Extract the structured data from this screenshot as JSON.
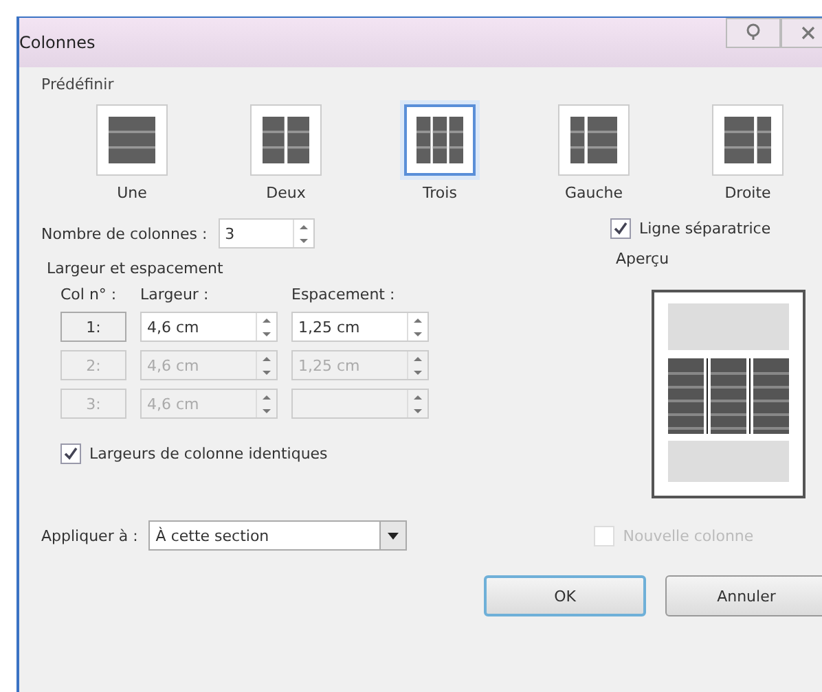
{
  "window": {
    "title": "Colonnes"
  },
  "presets": {
    "label": "Prédéfinir",
    "items": [
      {
        "label": "Une",
        "kind": "one",
        "selected": false
      },
      {
        "label": "Deux",
        "kind": "two",
        "selected": false
      },
      {
        "label": "Trois",
        "kind": "three",
        "selected": true
      },
      {
        "label": "Gauche",
        "kind": "left",
        "selected": false
      },
      {
        "label": "Droite",
        "kind": "right",
        "selected": false
      }
    ]
  },
  "column_count": {
    "label": "Nombre de colonnes :",
    "value": "3"
  },
  "separator": {
    "label": "Ligne séparatrice",
    "checked": true
  },
  "width_spacing": {
    "label": "Largeur et espacement",
    "headers": [
      "Col n° :",
      "Largeur :",
      "Espacement :"
    ],
    "rows": [
      {
        "number": "1:",
        "width": "4,6 cm",
        "spacing": "1,25 cm",
        "disabled": false
      },
      {
        "number": "2:",
        "width": "4,6 cm",
        "spacing": "1,25 cm",
        "disabled": true
      },
      {
        "number": "3:",
        "width": "4,6 cm",
        "disabled": true
      }
    ]
  },
  "preview": {
    "label": "Aperçu"
  },
  "equal_width": {
    "label": "Largeurs de colonne identiques",
    "checked": true
  },
  "apply_to": {
    "label": "Appliquer à :",
    "value": "À cette section"
  },
  "new_column": {
    "label": "Nouvelle colonne",
    "checked": false,
    "disabled": true
  },
  "buttons": [
    {
      "label": "OK",
      "default": true
    },
    {
      "label": "Annuler",
      "default": false
    }
  ]
}
